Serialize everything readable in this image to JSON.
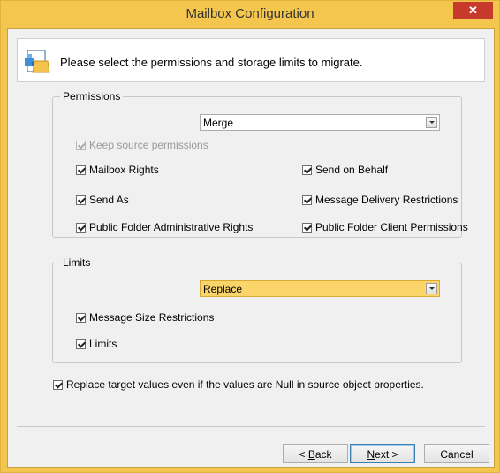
{
  "window": {
    "title": "Mailbox Configuration",
    "close_glyph": "✕"
  },
  "header": {
    "text": "Please select the permissions and storage limits to migrate.",
    "icon": "mailbox-folder-icon"
  },
  "permissions": {
    "legend": "Permissions",
    "combo_value": "Merge",
    "keep_source": "Keep source permissions",
    "items": [
      {
        "label": "Mailbox Rights",
        "checked": true
      },
      {
        "label": "Send on Behalf",
        "checked": true
      },
      {
        "label": "Send As",
        "checked": true
      },
      {
        "label": "Message Delivery Restrictions",
        "checked": true
      },
      {
        "label": "Public Folder Administrative Rights",
        "checked": true
      },
      {
        "label": "Public Folder Client Permissions",
        "checked": true
      }
    ]
  },
  "limits": {
    "legend": "Limits",
    "combo_value": "Replace",
    "items": [
      {
        "label": "Message Size Restrictions",
        "checked": true
      },
      {
        "label": "Limits",
        "checked": true
      }
    ]
  },
  "replace_null": {
    "label": "Replace target values even if the values are Null in source object properties.",
    "checked": true
  },
  "buttons": {
    "back_prefix": "< ",
    "back_key": "B",
    "back_rest": "ack",
    "next_key": "N",
    "next_rest": "ext >",
    "cancel": "Cancel"
  },
  "colors": {
    "title_bar": "#f5c64e",
    "close": "#c7392b",
    "combo_highlight": "#fbd46a"
  }
}
